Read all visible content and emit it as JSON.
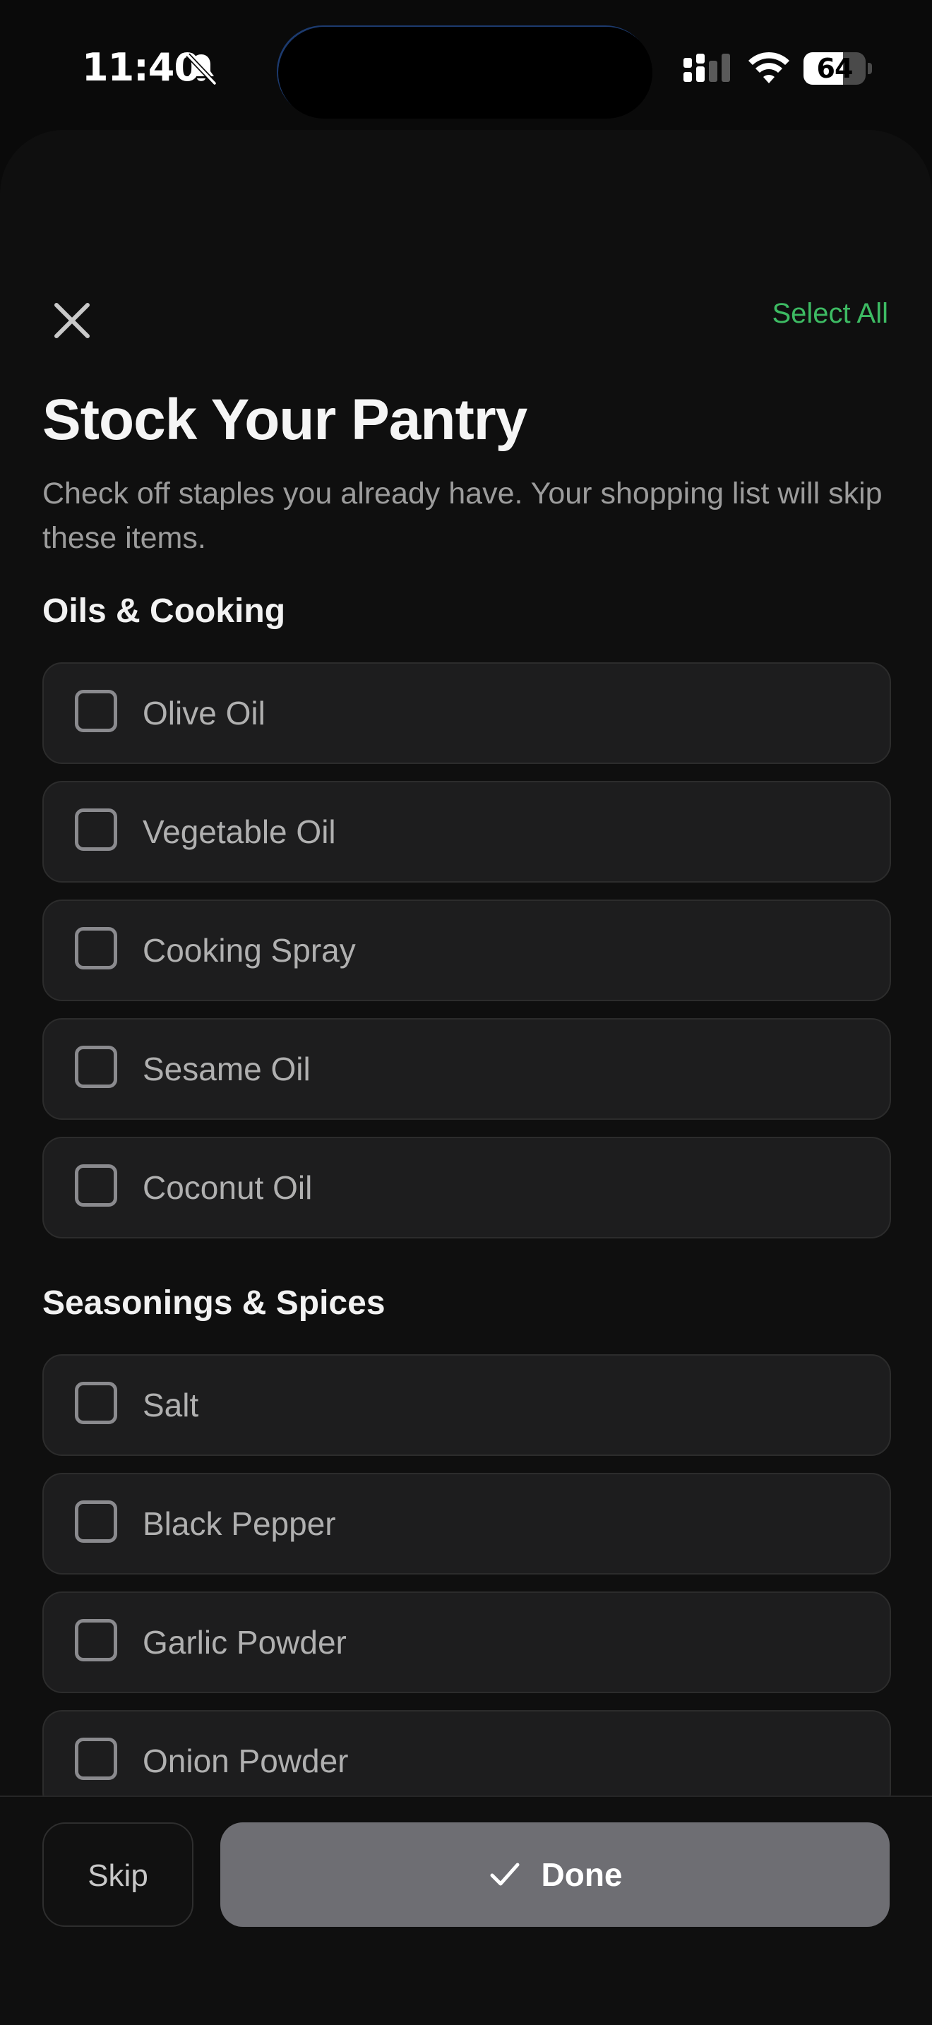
{
  "status_bar": {
    "time": "11:40",
    "battery_level": "64",
    "icons": [
      "bell-slash-icon",
      "cellular-signal-icon",
      "wifi-icon",
      "battery-icon"
    ]
  },
  "header": {
    "close_icon": "close-icon",
    "select_all_label": "Select All"
  },
  "page": {
    "title": "Stock Your Pantry",
    "subtitle": "Check off staples you already have. Your shopping list will skip these items."
  },
  "sections": [
    {
      "heading": "Oils & Cooking",
      "items": [
        {
          "label": "Olive Oil",
          "checked": false
        },
        {
          "label": "Vegetable Oil",
          "checked": false
        },
        {
          "label": "Cooking Spray",
          "checked": false
        },
        {
          "label": "Sesame Oil",
          "checked": false
        },
        {
          "label": "Coconut Oil",
          "checked": false
        }
      ]
    },
    {
      "heading": "Seasonings & Spices",
      "items": [
        {
          "label": "Salt",
          "checked": false
        },
        {
          "label": "Black Pepper",
          "checked": false
        },
        {
          "label": "Garlic Powder",
          "checked": false
        },
        {
          "label": "Onion Powder",
          "checked": false
        }
      ]
    }
  ],
  "footer": {
    "skip_label": "Skip",
    "done_label": "Done",
    "done_icon": "checkmark-icon"
  },
  "colors": {
    "accent": "#3dbb63",
    "background": "#0f0f0f",
    "item_background": "#1d1d1e",
    "done_button": "#6e6e73"
  }
}
